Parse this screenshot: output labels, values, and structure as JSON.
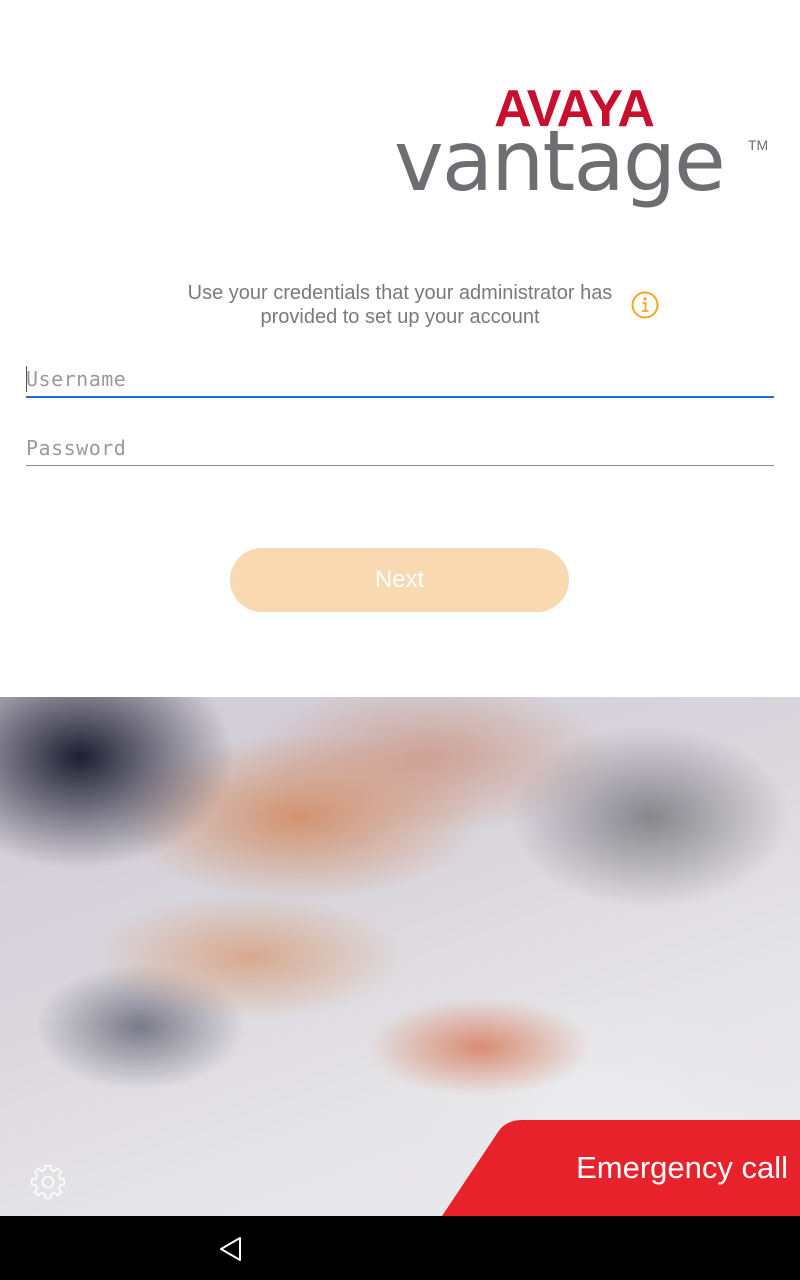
{
  "logo": {
    "brand": "AVAYA",
    "product": "vantage",
    "trademark": "TM",
    "colors": {
      "brand": "#c8102e",
      "product": "#6d6e71"
    }
  },
  "instructions": {
    "line1": "Use your credentials that your administrator has",
    "line2": "provided to set up your account"
  },
  "info_icon": {
    "icon": "info-icon",
    "color": "#f5a623"
  },
  "form": {
    "username": {
      "value": "",
      "placeholder": "Username"
    },
    "password": {
      "value": "",
      "placeholder": "Password"
    }
  },
  "next_button": {
    "label": "Next",
    "color": "#f8d9b2"
  },
  "hero_image": {
    "description_icon": "blurred-photo"
  },
  "settings": {
    "icon": "gear-icon"
  },
  "emergency": {
    "label": "Emergency call",
    "color": "#e8222a"
  },
  "navbar": {
    "back_icon": "back-triangle-icon"
  }
}
